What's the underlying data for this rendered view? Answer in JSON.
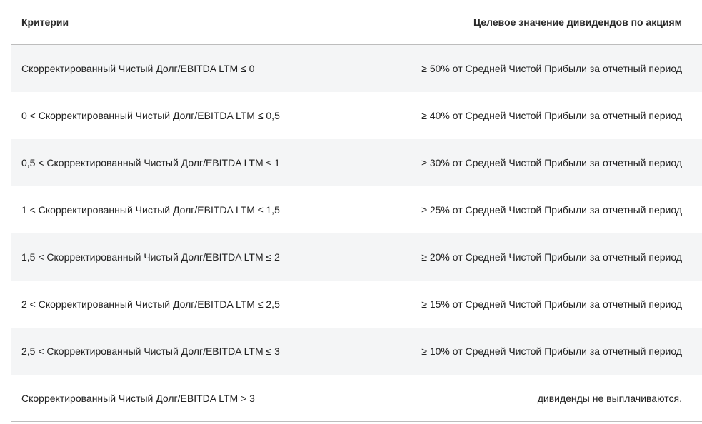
{
  "table": {
    "headers": {
      "criteria": "Критерии",
      "target": "Целевое значение дивидендов по акциям"
    },
    "rows": [
      {
        "criteria": "Скорректированный Чистый Долг/EBITDA LTM ≤ 0",
        "target": "≥ 50% от Средней Чистой Прибыли за отчетный период"
      },
      {
        "criteria": "0 < Скорректированный Чистый Долг/EBITDA LTM ≤ 0,5",
        "target": "≥ 40% от Средней Чистой Прибыли за отчетный период"
      },
      {
        "criteria": "0,5 < Скорректированный Чистый Долг/EBITDA LTM ≤ 1",
        "target": "≥ 30% от Средней Чистой Прибыли за отчетный период"
      },
      {
        "criteria": "1 < Скорректированный Чистый Долг/EBITDA LTM ≤ 1,5",
        "target": "≥ 25% от Средней Чистой Прибыли за отчетный период"
      },
      {
        "criteria": "1,5 < Скорректированный Чистый Долг/EBITDA LTM ≤ 2",
        "target": "≥ 20% от Средней Чистой Прибыли за отчетный период"
      },
      {
        "criteria": "2 < Скорректированный Чистый Долг/EBITDA LTM ≤ 2,5",
        "target": "≥ 15% от Средней Чистой Прибыли за отчетный период"
      },
      {
        "criteria": "2,5 < Скорректированный Чистый Долг/EBITDA LTM ≤ 3",
        "target": "≥ 10% от Средней Чистой Прибыли за отчетный период"
      },
      {
        "criteria": "Скорректированный Чистый Долг/EBITDA LTM > 3",
        "target": "дивиденды не выплачиваются."
      }
    ]
  },
  "colors": {
    "shaded_row": "#f4f5f6",
    "divider": "#bdbdbd"
  }
}
